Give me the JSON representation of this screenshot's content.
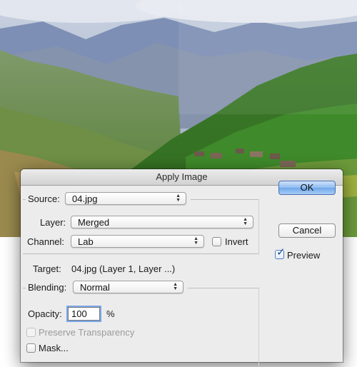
{
  "dialog": {
    "title": "Apply Image",
    "source": {
      "label": "Source:",
      "value": "04.jpg"
    },
    "layer": {
      "label": "Layer:",
      "value": "Merged"
    },
    "channel": {
      "label": "Channel:",
      "value": "Lab"
    },
    "invert": {
      "label": "Invert",
      "checked": false
    },
    "target": {
      "label": "Target:",
      "value": "04.jpg (Layer 1, Layer ...)"
    },
    "blending": {
      "label": "Blending:",
      "value": "Normal"
    },
    "opacity": {
      "label": "Opacity:",
      "value": "100",
      "unit": "%"
    },
    "preserve_transparency": {
      "label": "Preserve Transparency",
      "checked": false,
      "enabled": false
    },
    "mask": {
      "label": "Mask...",
      "checked": false
    },
    "buttons": {
      "ok": "OK",
      "cancel": "Cancel"
    },
    "preview": {
      "label": "Preview",
      "checked": true
    }
  },
  "icons": {
    "popup_arrows": "updown-chevron-icon",
    "checkmark": "checkmark-icon"
  },
  "colors": {
    "dialog_bg": "#ececec",
    "default_button": "#6ea6ea",
    "focus_ring": "#7aa7e8"
  }
}
